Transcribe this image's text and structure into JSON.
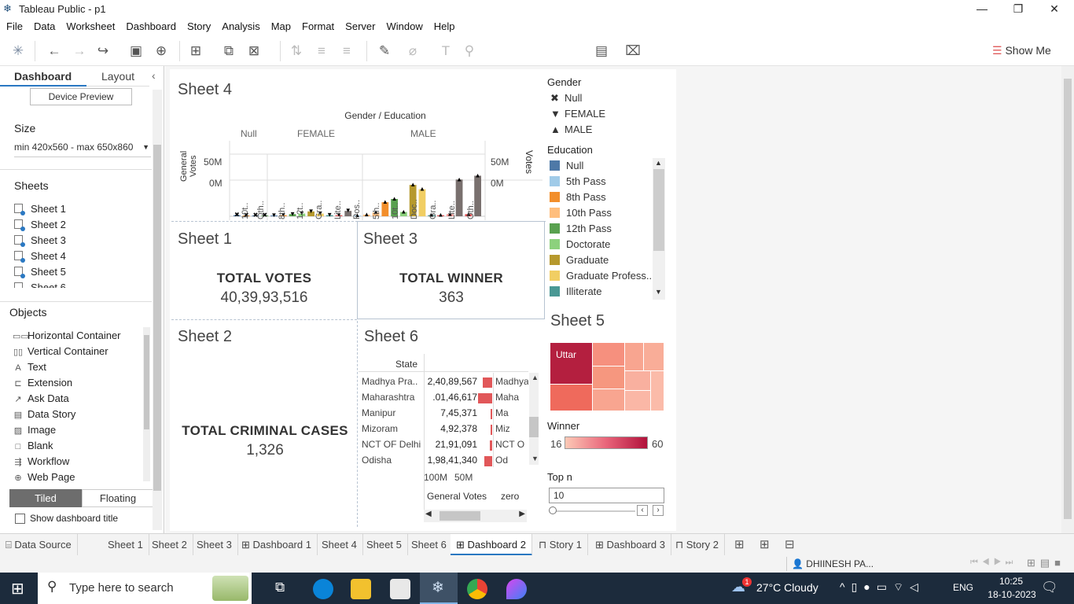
{
  "window": {
    "title": "Tableau Public - p1"
  },
  "menu": [
    "File",
    "Data",
    "Worksheet",
    "Dashboard",
    "Story",
    "Analysis",
    "Map",
    "Format",
    "Server",
    "Window",
    "Help"
  ],
  "toolbar": {
    "show_me": "Show Me"
  },
  "left": {
    "tab_dashboard": "Dashboard",
    "tab_layout": "Layout",
    "device_preview": "Device Preview",
    "size_label": "Size",
    "size_value": "min 420x560 - max 650x860",
    "sheets_label": "Sheets",
    "sheets": [
      "Sheet 1",
      "Sheet 2",
      "Sheet 3",
      "Sheet 4",
      "Sheet 5",
      "Sheet 6"
    ],
    "objects_label": "Objects",
    "objects": [
      {
        "icon": "horizontal-container-icon",
        "label": "Horizontal Container"
      },
      {
        "icon": "vertical-container-icon",
        "label": "Vertical Container"
      },
      {
        "icon": "text-icon",
        "label": "Text"
      },
      {
        "icon": "extension-icon",
        "label": "Extension"
      },
      {
        "icon": "ask-data-icon",
        "label": "Ask Data"
      },
      {
        "icon": "data-story-icon",
        "label": "Data Story"
      },
      {
        "icon": "image-icon",
        "label": "Image"
      },
      {
        "icon": "blank-icon",
        "label": "Blank"
      },
      {
        "icon": "workflow-icon",
        "label": "Workflow"
      },
      {
        "icon": "web-page-icon",
        "label": "Web Page"
      }
    ],
    "tiled": "Tiled",
    "floating": "Floating",
    "show_title": "Show dashboard title"
  },
  "sheet4": {
    "title": "Sheet 4",
    "header": "Gender / Education",
    "groups": [
      "Null",
      "FEMALE",
      "MALE"
    ],
    "y_left": "General Votes",
    "y_right": "Votes",
    "ticks": [
      "50M",
      "0M"
    ],
    "xlabels": [
      "10t..",
      "Oth..",
      "8th..",
      "12t..",
      "Gra..",
      "Lite..",
      "Pos..",
      "5th..",
      "10t..",
      "Doc..",
      "Gra..",
      "Lite..",
      "Oth.."
    ]
  },
  "chart_data": {
    "type": "bar",
    "title": "Gender / Education",
    "ylabel": "General Votes",
    "ylim": [
      0,
      100
    ],
    "categories": [
      "Null",
      "Null",
      "Null",
      "Null",
      "FEMALE",
      "FEMALE",
      "FEMALE",
      "FEMALE",
      "FEMALE",
      "FEMALE",
      "FEMALE",
      "FEMALE",
      "FEMALE",
      "MALE",
      "MALE",
      "MALE",
      "MALE",
      "MALE",
      "MALE",
      "MALE",
      "MALE",
      "MALE",
      "MALE",
      "MALE",
      "MALE",
      "MALE",
      "MALE"
    ],
    "values": [
      2,
      1,
      1,
      1,
      1,
      2,
      4,
      5,
      9,
      5,
      2,
      2,
      10,
      1,
      3,
      7,
      26,
      32,
      8,
      58,
      50,
      2,
      2,
      4,
      68,
      4,
      75
    ],
    "colors": [
      "#4e79a7",
      "#f28e2b",
      "#4e79a7",
      "#59a14f",
      "#4e79a7",
      "#f28e2b",
      "#59a14f",
      "#8cd17d",
      "#b6992d",
      "#f1ce63",
      "#499894",
      "#e15759",
      "#79706e",
      "#a0cbe8",
      "#ffbe7d",
      "#ffbe7d",
      "#f28e2b",
      "#59a14f",
      "#8cd17d",
      "#b6992d",
      "#f1ce63",
      "#499894",
      "#e15759",
      "#ff9d9a",
      "#79706e",
      "#e15759",
      "#79706e"
    ]
  },
  "sheet1": {
    "title": "Sheet 1",
    "label": "TOTAL VOTES",
    "value": "40,39,93,516"
  },
  "sheet3": {
    "title": "Sheet 3",
    "label": "TOTAL WINNER",
    "value": "363"
  },
  "sheet2": {
    "title": "Sheet 2",
    "label": "TOTAL CRIMINAL CASES",
    "value": "1,326"
  },
  "sheet6": {
    "title": "Sheet 6",
    "col_state": "State",
    "axis_ticks": [
      "100M",
      "50M"
    ],
    "col_votes": "General Votes",
    "col_zero": "zero",
    "rows": [
      {
        "state": "Madhya Pra..",
        "votes": "2,40,89,567",
        "right": "Madhya"
      },
      {
        "state": "Maharashtra",
        "votes": ".01,46,617",
        "right": "Maha"
      },
      {
        "state": "Manipur",
        "votes": "7,45,371",
        "right": "Ma"
      },
      {
        "state": "Mizoram",
        "votes": "4,92,378",
        "right": "Miz"
      },
      {
        "state": "NCT OF Delhi",
        "votes": "21,91,091",
        "right": "NCT O"
      },
      {
        "state": "Odisha",
        "votes": "1,98,41,340",
        "right": "Od"
      }
    ],
    "bar_share": [
      0.6,
      0.9,
      0.1,
      0.1,
      0.15,
      0.5
    ]
  },
  "legend_gender": {
    "title": "Gender",
    "items": [
      {
        "mark": "✖",
        "label": "Null"
      },
      {
        "mark": "▼",
        "label": "FEMALE"
      },
      {
        "mark": "▲",
        "label": "MALE"
      }
    ]
  },
  "legend_edu": {
    "title": "Education",
    "items": [
      {
        "color": "#4e79a7",
        "label": "Null"
      },
      {
        "color": "#a0cbe8",
        "label": "5th Pass"
      },
      {
        "color": "#f28e2b",
        "label": "8th Pass"
      },
      {
        "color": "#ffbe7d",
        "label": "10th Pass"
      },
      {
        "color": "#59a14f",
        "label": "12th Pass"
      },
      {
        "color": "#8cd17d",
        "label": "Doctorate"
      },
      {
        "color": "#b6992d",
        "label": "Graduate"
      },
      {
        "color": "#f1ce63",
        "label": "Graduate Profess.."
      },
      {
        "color": "#499894",
        "label": "Illiterate"
      }
    ]
  },
  "sheet5": {
    "title": "Sheet 5",
    "top_label": "Uttar"
  },
  "winner_legend": {
    "title": "Winner",
    "min": "16",
    "max": "60"
  },
  "topn": {
    "label": "Top n",
    "value": "10"
  },
  "tabs": [
    "Data Source",
    "Sheet 1",
    "Sheet 2",
    "Sheet 3",
    "Dashboard 1",
    "Sheet 4",
    "Sheet 5",
    "Sheet 6",
    "Dashboard 2",
    "Story 1",
    "Dashboard 3",
    "Story 2"
  ],
  "active_tab": "Dashboard 2",
  "status": {
    "user": "DHIINESH PA..."
  },
  "taskbar": {
    "search": "Type here to search",
    "weather": "27°C  Cloudy",
    "lang": "ENG",
    "time": "10:25",
    "date": "18-10-2023",
    "notif": "1"
  }
}
